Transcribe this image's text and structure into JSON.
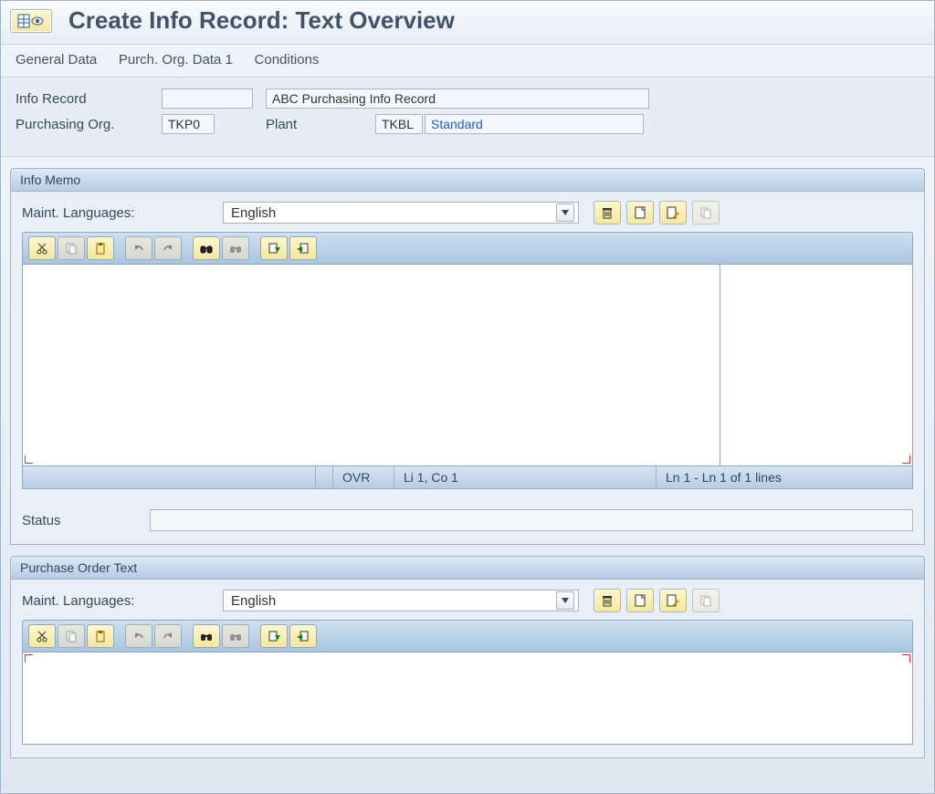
{
  "title": "Create Info Record: Text Overview",
  "menu": {
    "general": "General Data",
    "purch": "Purch. Org. Data 1",
    "cond": "Conditions"
  },
  "header": {
    "infoRecordLabel": "Info Record",
    "infoRecordValue": "",
    "infoRecordDesc": "ABC Purchasing Info Record",
    "purchOrgLabel": "Purchasing Org.",
    "purchOrgValue": "TKP0",
    "plantLabel": "Plant",
    "plantValue": "TKBL",
    "categoryValue": "Standard"
  },
  "infoMemo": {
    "title": "Info Memo",
    "maintLangLabel": "Maint. Languages:",
    "language": "English",
    "status": {
      "ovr": "OVR",
      "lico": "Li 1, Co 1",
      "ln": "Ln 1 - Ln 1 of 1 lines"
    },
    "statusLabel": "Status",
    "statusValue": ""
  },
  "poText": {
    "title": "Purchase Order Text",
    "maintLangLabel": "Maint. Languages:",
    "language": "English"
  }
}
